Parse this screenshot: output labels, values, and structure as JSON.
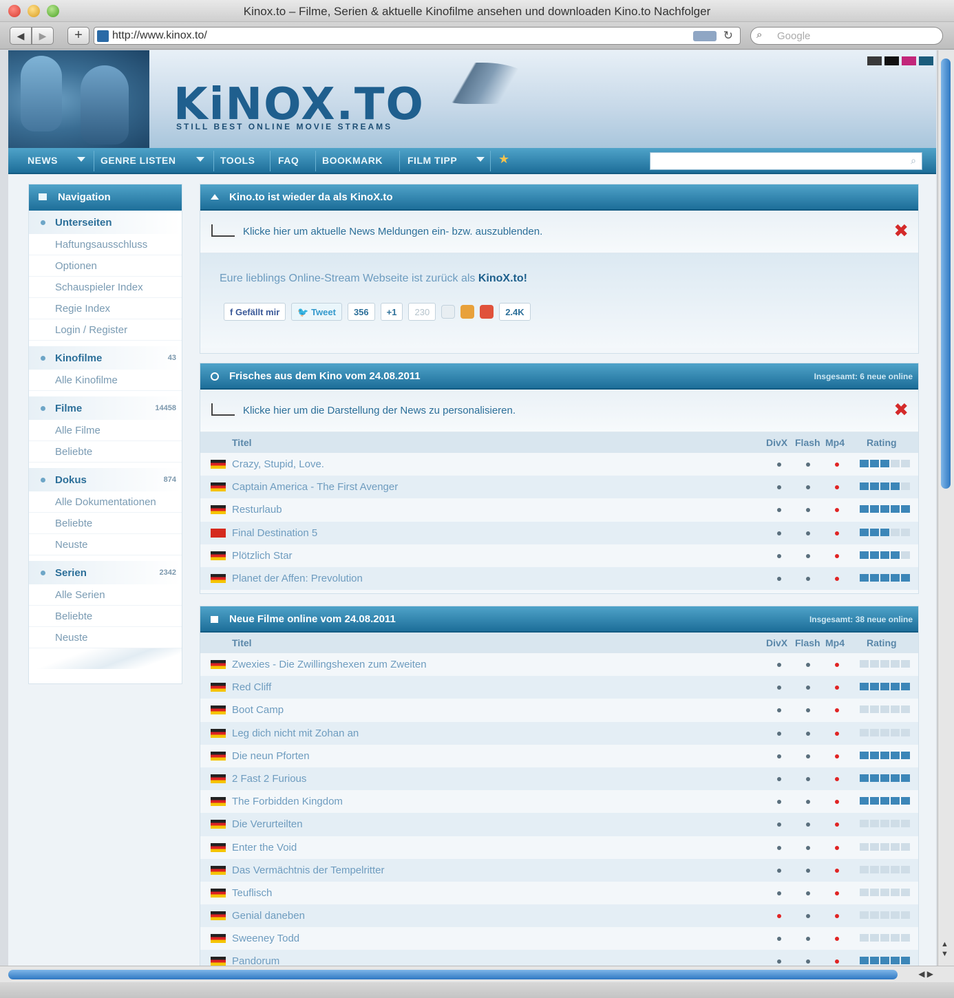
{
  "window": {
    "title": "Kinox.to – Filme, Serien & aktuelle Kinofilme ansehen und downloaden Kino.to Nachfolger",
    "url": "http://www.kinox.to/",
    "search_placeholder": "Google"
  },
  "header": {
    "logo": "KiNOX.TO",
    "tagline": "STILL BEST ONLINE MOVIE STREAMS",
    "swatch_colors": [
      "#3a3a3a",
      "#111111",
      "#c2267a",
      "#1b5c7c"
    ]
  },
  "menu": {
    "items": [
      "NEWS",
      "GENRE LISTEN",
      "TOOLS",
      "FAQ",
      "BOOKMARK",
      "FILM TIPP"
    ]
  },
  "sidebar": {
    "title": "Navigation",
    "sections": [
      {
        "label": "Unterseiten",
        "count": "",
        "links": [
          "Haftungsausschluss",
          "Optionen",
          "Schauspieler Index",
          "Regie Index",
          "Login / Register"
        ]
      },
      {
        "label": "Kinofilme",
        "count": "43",
        "links": [
          "Alle Kinofilme"
        ]
      },
      {
        "label": "Filme",
        "count": "14458",
        "links": [
          "Alle Filme",
          "Beliebte"
        ]
      },
      {
        "label": "Dokus",
        "count": "874",
        "links": [
          "Alle Dokumentationen",
          "Beliebte",
          "Neuste"
        ]
      },
      {
        "label": "Serien",
        "count": "2342",
        "links": [
          "Alle Serien",
          "Beliebte",
          "Neuste"
        ]
      }
    ]
  },
  "news_panel": {
    "title": "Kino.to ist wieder da als KinoX.to",
    "notice": "Klicke hier um aktuelle News Meldungen ein- bzw. auszublenden.",
    "intro": "Eure lieblings Online-Stream Webseite ist zurück als",
    "intro_bold": "KinoX.to!",
    "social": {
      "like": "Gefällt mir",
      "tweet": "Tweet",
      "tweet_count": "356",
      "plus": "+1",
      "plus_count": "230",
      "share_count": "2.4K"
    }
  },
  "kino_panel": {
    "title": "Frisches aus dem Kino vom 24.08.2011",
    "right": "Insgesamt: 6 neue online",
    "notice": "Klicke hier um die Darstellung der News zu personalisieren.",
    "columns": {
      "title": "Titel",
      "divx": "DivX",
      "flash": "Flash",
      "mp4": "Mp4",
      "rating": "Rating"
    },
    "rows": [
      {
        "title": "Crazy, Stupid, Love.",
        "flag": "de",
        "rating": 3,
        "divx_red": false
      },
      {
        "title": "Captain America - The First Avenger",
        "flag": "de",
        "rating": 4,
        "divx_red": false
      },
      {
        "title": "Resturlaub",
        "flag": "de",
        "rating": 5,
        "divx_red": false
      },
      {
        "title": "Final Destination 5",
        "flag": "ch",
        "rating": 3,
        "divx_red": false
      },
      {
        "title": "Plötzlich Star",
        "flag": "de",
        "rating": 4,
        "divx_red": false
      },
      {
        "title": "Planet der Affen: Prevolution",
        "flag": "de",
        "rating": 5,
        "divx_red": false
      }
    ]
  },
  "films_panel": {
    "title": "Neue Filme online vom 24.08.2011",
    "right": "Insgesamt: 38 neue online",
    "columns": {
      "title": "Titel",
      "divx": "DivX",
      "flash": "Flash",
      "mp4": "Mp4",
      "rating": "Rating"
    },
    "rows": [
      {
        "title": "Zwexies - Die Zwillingshexen zum Zweiten",
        "flag": "de",
        "rating": 0,
        "divx_red": false
      },
      {
        "title": "Red Cliff",
        "flag": "de",
        "rating": 5,
        "divx_red": false
      },
      {
        "title": "Boot Camp",
        "flag": "de",
        "rating": 0,
        "divx_red": false
      },
      {
        "title": "Leg dich nicht mit Zohan an",
        "flag": "de",
        "rating": 0,
        "divx_red": false
      },
      {
        "title": "Die neun Pforten",
        "flag": "de",
        "rating": 5,
        "divx_red": false
      },
      {
        "title": "2 Fast 2 Furious",
        "flag": "de",
        "rating": 5,
        "divx_red": false
      },
      {
        "title": "The Forbidden Kingdom",
        "flag": "de",
        "rating": 5,
        "divx_red": false
      },
      {
        "title": "Die Verurteilten",
        "flag": "de",
        "rating": 0,
        "divx_red": false
      },
      {
        "title": "Enter the Void",
        "flag": "de",
        "rating": 0,
        "divx_red": false
      },
      {
        "title": "Das Vermächtnis der Tempelritter",
        "flag": "de",
        "rating": 0,
        "divx_red": false
      },
      {
        "title": "Teuflisch",
        "flag": "de",
        "rating": 0,
        "divx_red": false
      },
      {
        "title": "Genial daneben",
        "flag": "de",
        "rating": 0,
        "divx_red": true
      },
      {
        "title": "Sweeney Todd",
        "flag": "de",
        "rating": 0,
        "divx_red": false
      },
      {
        "title": "Pandorum",
        "flag": "de",
        "rating": 5,
        "divx_red": false
      }
    ]
  }
}
